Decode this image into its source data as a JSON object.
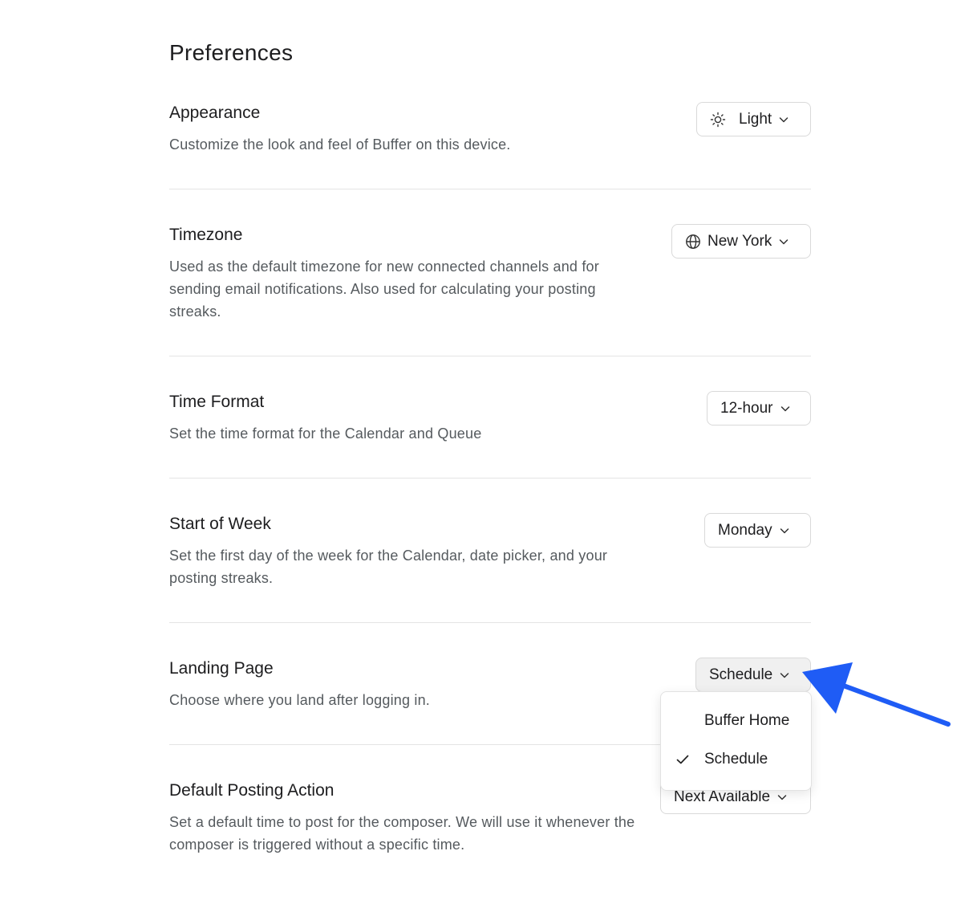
{
  "page_title": "Preferences",
  "sections": {
    "appearance": {
      "title": "Appearance",
      "description": "Customize the look and feel of Buffer on this device.",
      "value": "Light",
      "icon": "sun-icon"
    },
    "timezone": {
      "title": "Timezone",
      "description": "Used as the default timezone for new connected channels and for sending email notifications. Also used for calculating your posting streaks.",
      "value": "New York",
      "icon": "globe-icon"
    },
    "time_format": {
      "title": "Time Format",
      "description": "Set the time format for the Calendar and Queue",
      "value": "12-hour"
    },
    "start_of_week": {
      "title": "Start of Week",
      "description": "Set the first day of the week for the Calendar, date picker, and your posting streaks.",
      "value": "Monday"
    },
    "landing_page": {
      "title": "Landing Page",
      "description": "Choose where you land after logging in.",
      "value": "Schedule",
      "menu_open": true,
      "options": [
        {
          "label": "Buffer Home",
          "selected": false
        },
        {
          "label": "Schedule",
          "selected": true
        }
      ]
    },
    "default_posting_action": {
      "title": "Default Posting Action",
      "description": "Set a default time to post for the composer. We will use it whenever the composer is triggered without a specific time.",
      "value": "Next Available"
    }
  },
  "annotation": {
    "arrow_color": "#1f5cf5",
    "points_to": "landing-page-select"
  }
}
